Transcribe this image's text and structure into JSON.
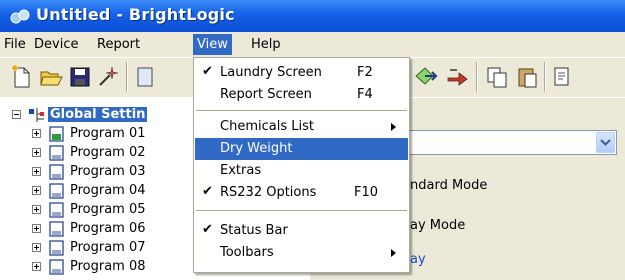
{
  "window": {
    "title": "Untitled - BrightLogic"
  },
  "menubar": {
    "items": [
      "File",
      "Device",
      "Report",
      "View",
      "Help"
    ],
    "open": "View"
  },
  "toolbar": {
    "icons": [
      "new-file-icon",
      "open-folder-icon",
      "save-icon",
      "wizard-icon",
      "device-icon",
      "connect-icon",
      "send-icon",
      "copy-icon",
      "paste-icon",
      "edit-icon"
    ]
  },
  "tree": {
    "root_label": "Global Settin",
    "items": [
      "Program 01",
      "Program 02",
      "Program 03",
      "Program 04",
      "Program 05",
      "Program 06",
      "Program 07",
      "Program 08"
    ]
  },
  "right_panel": {
    "standard_mode": "ndard Mode",
    "display_mode": "ay Mode",
    "group_label": "ay"
  },
  "view_menu": {
    "items": [
      {
        "label": "Laundry Screen",
        "shortcut": "F2",
        "checked": true
      },
      {
        "label": "Report Screen",
        "shortcut": "F4",
        "checked": false
      },
      {
        "label": "Chemicals List",
        "submenu": true
      },
      {
        "label": "Dry Weight",
        "highlighted": true
      },
      {
        "label": "Extras"
      },
      {
        "label": "RS232 Options",
        "shortcut": "F10",
        "checked": true
      },
      {
        "label": "Status Bar",
        "checked": true
      },
      {
        "label": "Toolbars",
        "submenu": true
      }
    ],
    "check_glyph": "✔"
  },
  "colors": {
    "title_bar": "#0a4fd6",
    "selection": "#316ac5",
    "chrome": "#ece9d8"
  }
}
